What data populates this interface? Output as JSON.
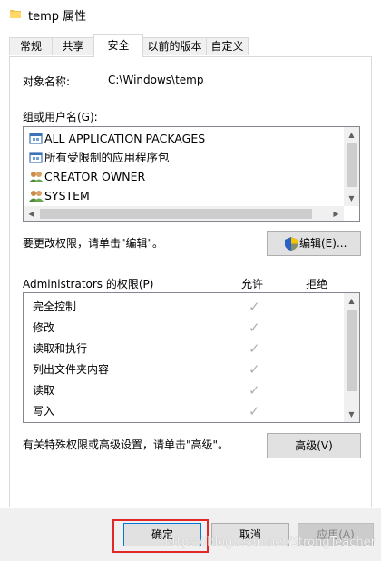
{
  "window": {
    "title": "temp 属性"
  },
  "tabs": [
    {
      "label": "常规",
      "active": false
    },
    {
      "label": "共享",
      "active": false
    },
    {
      "label": "安全",
      "active": true
    },
    {
      "label": "以前的版本",
      "active": false
    },
    {
      "label": "自定义",
      "active": false
    }
  ],
  "security": {
    "object_name_label": "对象名称:",
    "object_name_value": "C:\\Windows\\temp",
    "group_label": "组或用户名(G):",
    "users": [
      {
        "label": "ALL APPLICATION PACKAGES",
        "icon": "app-package-icon"
      },
      {
        "label": "所有受限制的应用程序包",
        "icon": "app-package-icon"
      },
      {
        "label": "CREATOR OWNER",
        "icon": "users-icon"
      },
      {
        "label": "SYSTEM",
        "icon": "users-icon"
      }
    ],
    "edit_hint": "要更改权限，请单击\"编辑\"。",
    "edit_button": "编辑(E)...",
    "permissions_label": "Administrators 的权限(P)",
    "allow_header": "允许",
    "deny_header": "拒绝",
    "permissions": [
      {
        "name": "完全控制",
        "allow": true,
        "deny": false
      },
      {
        "name": "修改",
        "allow": true,
        "deny": false
      },
      {
        "name": "读取和执行",
        "allow": true,
        "deny": false
      },
      {
        "name": "列出文件夹内容",
        "allow": true,
        "deny": false
      },
      {
        "name": "读取",
        "allow": true,
        "deny": false
      },
      {
        "name": "写入",
        "allow": true,
        "deny": false
      }
    ],
    "advanced_hint": "有关特殊权限或高级设置，请单击\"高级\"。",
    "advanced_button": "高级(V)"
  },
  "footer": {
    "ok_button": "确定",
    "cancel_button": "取消",
    "apply_button": "应用(A)",
    "watermark": "https://blog.csdn.net/StrongTeacher"
  },
  "colors": {
    "highlight": "#e02828",
    "check": "#b0b0b0",
    "folder": "#f2c14e"
  }
}
